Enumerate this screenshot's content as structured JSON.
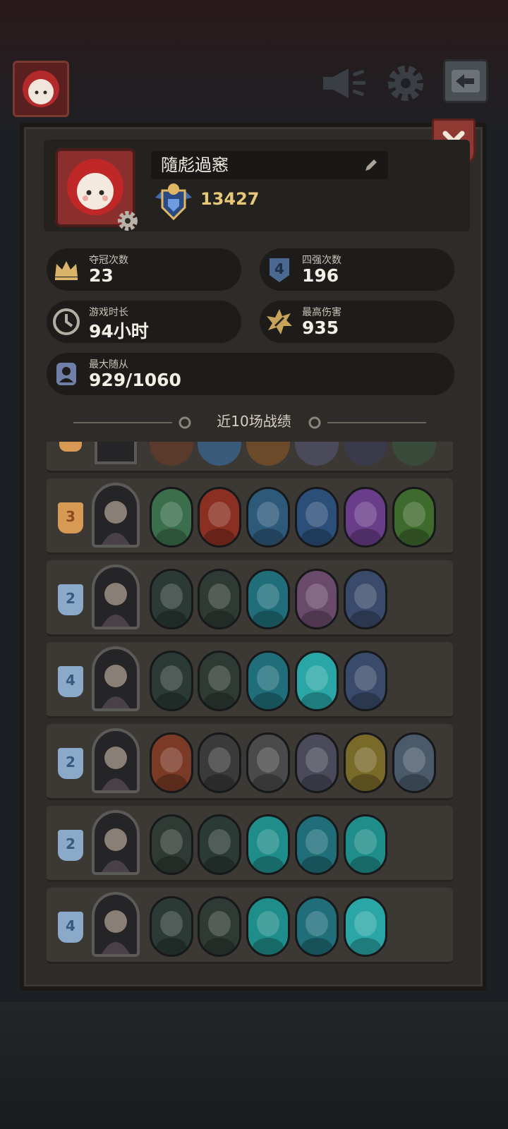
{
  "profile": {
    "name": "隨彪過窸",
    "rank_score": "13427"
  },
  "stats": {
    "championships": {
      "label": "夺冠次数",
      "value": "23"
    },
    "top4": {
      "label": "四强次数",
      "value": "196",
      "badge": "4"
    },
    "playtime": {
      "label": "游戏时长",
      "value": "94小时"
    },
    "max_damage": {
      "label": "最高伤害",
      "value": "935"
    },
    "max_followers": {
      "label": "最大随从",
      "value": "929/1060"
    }
  },
  "recent": {
    "title": "近10场战绩",
    "matches": [
      {
        "placement": "3",
        "tier": "gold",
        "units": [
          "#3b6e4a",
          "#8a2f22",
          "#2e5a7a",
          "#2b4f78",
          "#6a3d8a",
          "#3f6a2e"
        ]
      },
      {
        "placement": "2",
        "tier": "blue",
        "units": [
          "#2b3a34",
          "#2f3a34",
          "#1f6e7a",
          "#6a4a6a",
          "#3a4a6a"
        ]
      },
      {
        "placement": "4",
        "tier": "blue",
        "units": [
          "#2b3a34",
          "#2f3a34",
          "#1f6e7a",
          "#2aa6a6",
          "#3a4a6a"
        ]
      },
      {
        "placement": "2",
        "tier": "blue",
        "units": [
          "#7a3a26",
          "#3a3a3a",
          "#4a4a4a",
          "#4a4a5a",
          "#7a6a2a",
          "#4a5a6a"
        ]
      },
      {
        "placement": "2",
        "tier": "blue",
        "units": [
          "#2f3a34",
          "#2b3a34",
          "#1f8e8a",
          "#1f6e7a",
          "#1f8e8a"
        ]
      },
      {
        "placement": "4",
        "tier": "blue",
        "units": [
          "#2b3a34",
          "#2f3a34",
          "#1f8e8a",
          "#1f6e7a",
          "#2aa6a6"
        ]
      }
    ]
  },
  "colors": {
    "panel": "#2e2b28",
    "gold": "#e6c879",
    "close": "#8e3a32"
  }
}
